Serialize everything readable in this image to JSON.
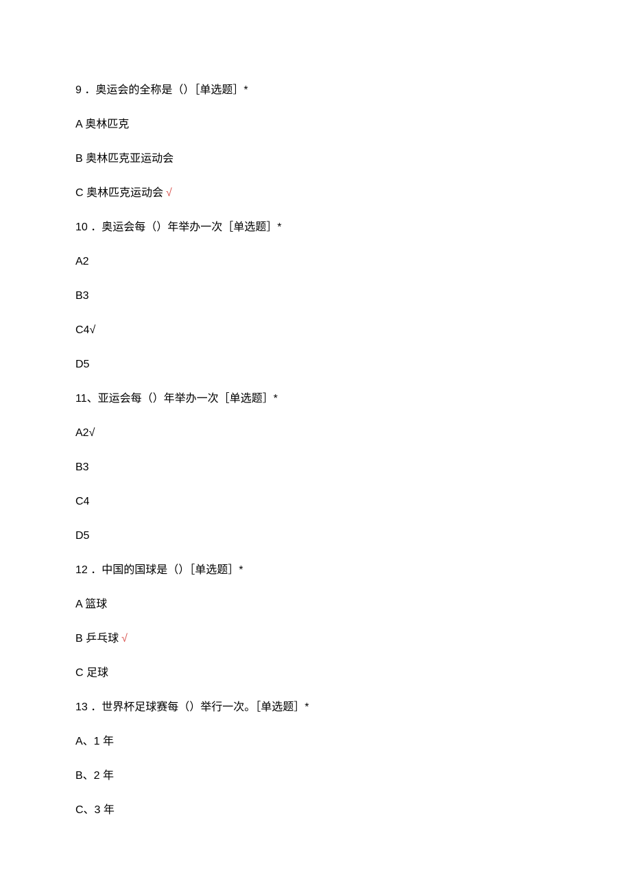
{
  "questions": [
    {
      "number": "9",
      "sep": "  ．",
      "text": "奥运会的全称是（）［单选题］*",
      "options": [
        {
          "label": "A 奥林匹克",
          "correct": false
        },
        {
          "label": "B 奥林匹克亚运动会",
          "correct": false
        },
        {
          "label": "C 奥林匹克运动会",
          "correct": true,
          "redCheck": true
        }
      ]
    },
    {
      "number": "10",
      "sep": "  ．",
      "text": "奥运会每（）年举办一次［单选题］*",
      "options": [
        {
          "label": "A2",
          "correct": false
        },
        {
          "label": "B3",
          "correct": false
        },
        {
          "label": "C4√",
          "correct": true,
          "redCheck": false
        },
        {
          "label": "D5",
          "correct": false
        }
      ]
    },
    {
      "number": "11",
      "sep": "、",
      "text": "亚运会每（）年举办一次［单选题］*",
      "options": [
        {
          "label": "A2√",
          "correct": true,
          "redCheck": false
        },
        {
          "label": "B3",
          "correct": false
        },
        {
          "label": "C4",
          "correct": false
        },
        {
          "label": "D5",
          "correct": false
        }
      ]
    },
    {
      "number": "12",
      "sep": "  ．",
      "text": "中国的国球是（）［单选题］*",
      "options": [
        {
          "label": "A 篮球",
          "correct": false
        },
        {
          "label": "B 乒乓球",
          "correct": true,
          "redCheck": true
        },
        {
          "label": "C 足球",
          "correct": false
        }
      ]
    },
    {
      "number": "13",
      "sep": "  ．",
      "text": "世界杯足球赛每（）举行一次。［单选题］*",
      "options": [
        {
          "label": "A、1 年",
          "correct": false
        },
        {
          "label": "B、2 年",
          "correct": false
        },
        {
          "label": "C、3 年",
          "correct": false
        }
      ]
    }
  ],
  "checkGlyph": "√"
}
